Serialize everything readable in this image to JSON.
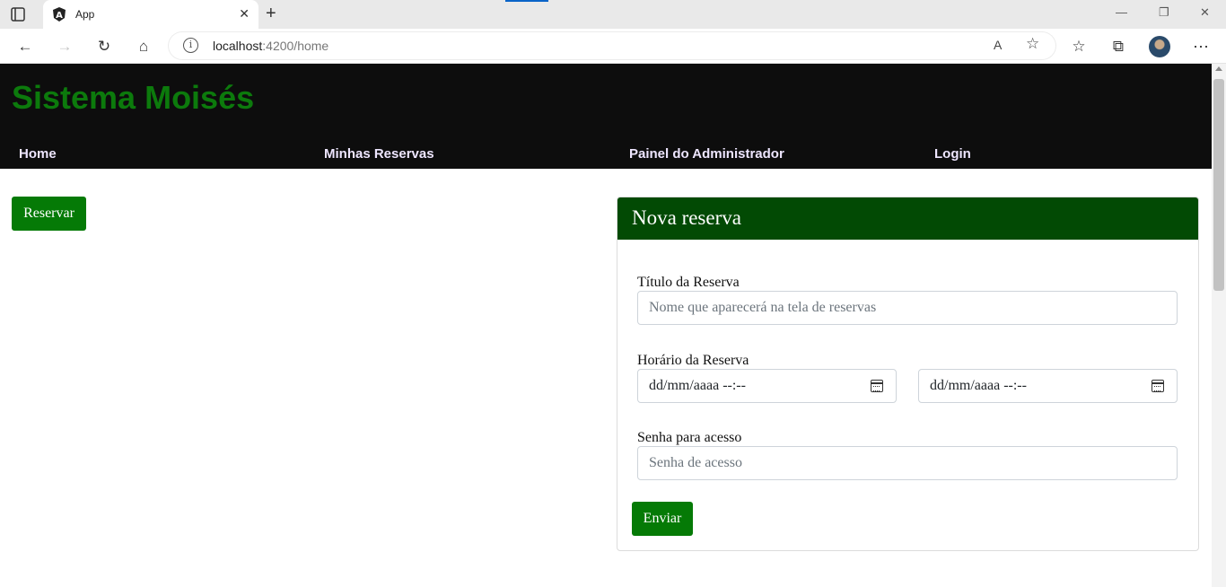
{
  "browser": {
    "tab_title": "App",
    "tab_close": "✕",
    "new_tab": "+",
    "address_host": "localhost",
    "address_rest": ":4200/home",
    "window_controls": [
      "—",
      "❐",
      "✕"
    ],
    "icons": {
      "back": "←",
      "forward": "→",
      "reload": "↻",
      "home": "⌂",
      "read_aloud": "A",
      "favorite_add": "☆",
      "favorites": "☆",
      "collections": "⧉",
      "menu": "⋯"
    }
  },
  "header": {
    "brand": "Sistema Moisés",
    "nav": [
      "Home",
      "Minhas Reservas",
      "Painel do Administrador",
      "Login"
    ]
  },
  "main": {
    "reserve_button": "Reservar"
  },
  "form": {
    "title": "Nova reserva",
    "titulo_label": "Título da Reserva",
    "titulo_placeholder": "Nome que aparecerá na tela de reservas",
    "horario_label": "Horário da Reserva",
    "start_value": "dd/mm/aaaa --:--",
    "end_value": "dd/mm/aaaa --:--",
    "senha_label": "Senha para acesso",
    "senha_placeholder": "Senha de acesso",
    "submit": "Enviar"
  },
  "colors": {
    "brand_green": "#0c7a0c",
    "button_green": "#057a06",
    "card_header_green": "#024a04",
    "header_bg": "#0d0d0d"
  }
}
